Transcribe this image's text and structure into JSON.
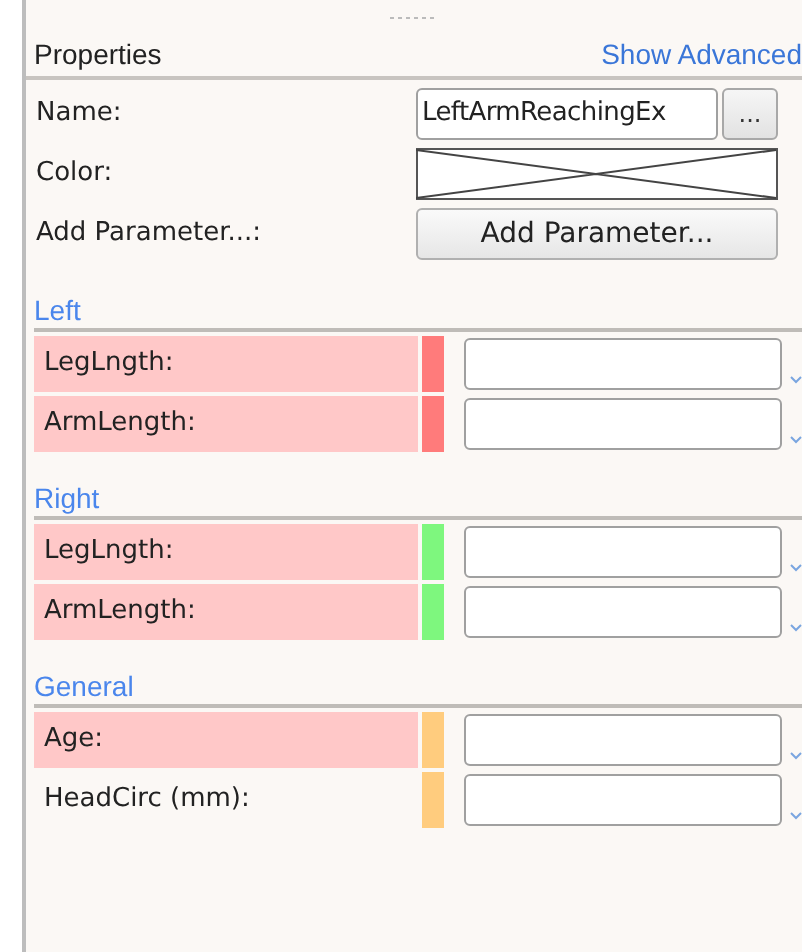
{
  "header": {
    "title": "Properties",
    "link": "Show Advanced"
  },
  "general_fields": [
    {
      "kind": "text",
      "label": "Name:",
      "value": "LeftArmReachingEx",
      "button": "..."
    },
    {
      "kind": "color",
      "label": "Color:"
    },
    {
      "kind": "button",
      "label": "Add Parameter...:",
      "button": "Add Parameter..."
    }
  ],
  "sections": [
    {
      "title": "Left",
      "rows": [
        {
          "label": "LegLngth:",
          "highlighted": true,
          "color": "#ff7b7b"
        },
        {
          "label": "ArmLength:",
          "highlighted": true,
          "color": "#ff7b7b"
        }
      ]
    },
    {
      "title": "Right",
      "rows": [
        {
          "label": "LegLngth:",
          "highlighted": true,
          "color": "#7ef77e"
        },
        {
          "label": "ArmLength:",
          "highlighted": true,
          "color": "#7ef77e"
        }
      ]
    },
    {
      "title": "General",
      "rows": [
        {
          "label": "Age:",
          "highlighted": true,
          "color": "#ffcc7e"
        },
        {
          "label": "HeadCirc (mm):",
          "highlighted": false,
          "color": "#ffcc7e"
        }
      ]
    }
  ]
}
